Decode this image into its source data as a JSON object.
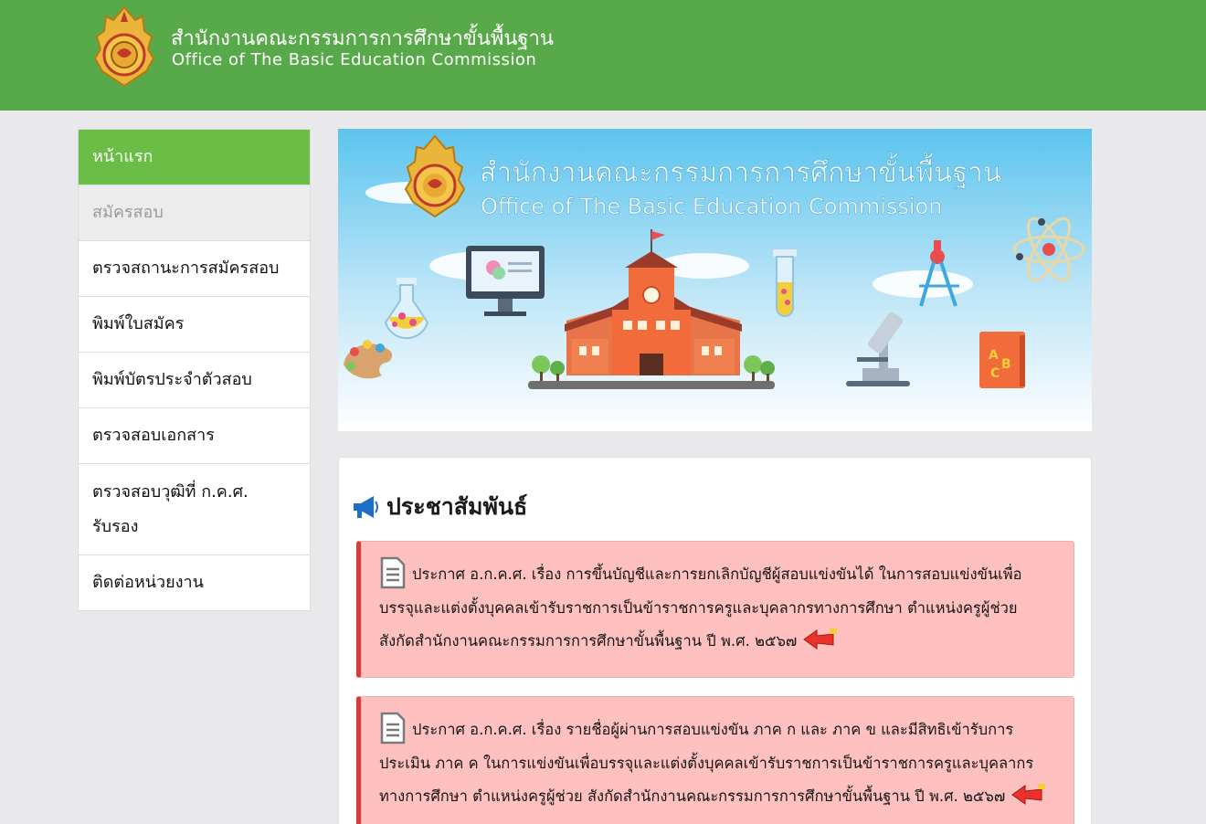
{
  "header": {
    "title_th": "สำนักงานคณะกรรมการการศึกษาขั้นพื้นฐาน",
    "title_en": "Office of The Basic Education Commission"
  },
  "sidebar": {
    "items": [
      {
        "label": "หน้าแรก"
      },
      {
        "label": "สมัครสอบ"
      },
      {
        "label": "ตรวจสถานะการสมัครสอบ"
      },
      {
        "label": "พิมพ์ใบสมัคร"
      },
      {
        "label": "พิมพ์บัตรประจำตัวสอบ"
      },
      {
        "label": "ตรวจสอบเอกสาร"
      },
      {
        "label": "ตรวจสอบวุฒิที่ ก.ค.ศ. รับรอง"
      },
      {
        "label": "ติดต่อหน่วยงาน"
      }
    ]
  },
  "banner": {
    "title_th": "สำนักงานคณะกรรมการการศึกษาขั้นพื้นฐาน",
    "title_en": "Office of The Basic Education Commission"
  },
  "news": {
    "heading": "ประชาสัมพันธ์",
    "items": [
      {
        "text": "ประกาศ อ.ก.ค.ศ. เรื่อง การขึ้นบัญชีและการยกเลิกบัญชีผู้สอบแข่งขันได้ ในการสอบแข่งขันเพื่อบรรจุและแต่งตั้งบุคคลเข้ารับราชการเป็นข้าราชการครูและบุคลากรทางการศึกษา ตำแหน่งครูผู้ช่วย สังกัดสำนักงานคณะกรรมการการศึกษาขั้นพื้นฐาน ปี พ.ศ. ๒๕๖๗"
      },
      {
        "text": "ประกาศ อ.ก.ค.ศ. เรื่อง รายชื่อผู้ผ่านการสอบแข่งขัน ภาค ก และ ภาค ข และมีสิทธิเข้ารับการประเมิน ภาค ค ในการแข่งขันเพื่อบรรจุและแต่งตั้งบุคคลเข้ารับราชการเป็นข้าราชการครูและบุคลากรทางการศึกษา ตำแหน่งครูผู้ช่วย สังกัดสำนักงานคณะกรรมการการศึกษาขั้นพื้นฐาน ปี พ.ศ. ๒๕๖๗"
      }
    ]
  },
  "colors": {
    "header_green": "#58a94a",
    "active_green": "#6abd45",
    "alert_bg": "#fec1c0",
    "alert_border": "#de3939"
  },
  "icons": [
    "emblem-logo",
    "megaphone-icon",
    "document-icon",
    "pointing-arrow-icon"
  ]
}
